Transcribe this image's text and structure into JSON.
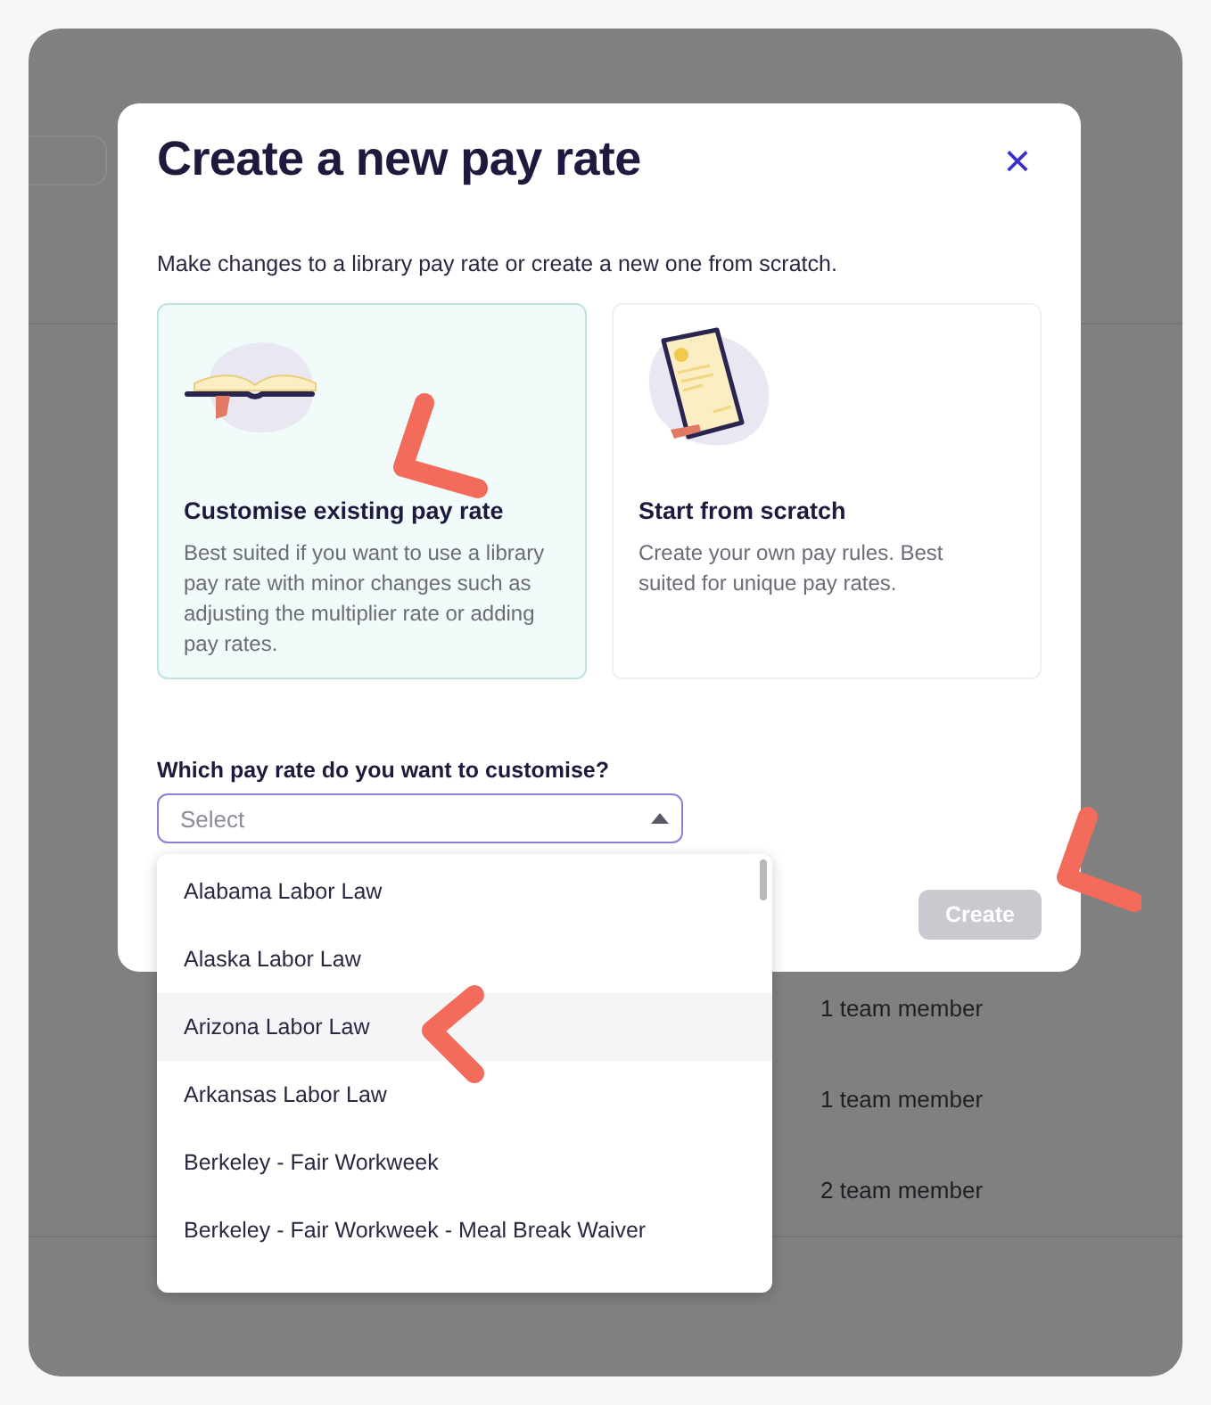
{
  "background_table": {
    "rows": [
      {
        "members": "1 team member"
      },
      {
        "members": "1 team member"
      },
      {
        "members": "2 team member"
      }
    ]
  },
  "dialog": {
    "title": "Create a new pay rate",
    "close": "×",
    "intro": "Make changes to a library pay rate or create a new one from scratch.",
    "options": [
      {
        "kind": "library",
        "title": "Customise existing pay rate",
        "description": "Best suited if you want to use a library pay rate with minor changes such as adjusting the multiplier rate or adding pay rates.",
        "selected": true
      },
      {
        "kind": "scratch",
        "title": "Start from scratch",
        "description": "Create your own pay rules. Best suited for unique pay rates.",
        "selected": false
      }
    ],
    "select_label": "Which pay rate do you want to customise?",
    "select": {
      "placeholder": "Select",
      "expanded": true
    },
    "create_button": {
      "label": "Create",
      "disabled": true
    }
  },
  "dropdown": {
    "items": [
      {
        "label": "Alabama Labor Law",
        "highlighted": false
      },
      {
        "label": "Alaska Labor Law",
        "highlighted": false
      },
      {
        "label": "Arizona Labor Law",
        "highlighted": true
      },
      {
        "label": "Arkansas Labor Law",
        "highlighted": false
      },
      {
        "label": "Berkeley - Fair Workweek",
        "highlighted": false
      },
      {
        "label": "Berkeley - Fair Workweek - Meal Break Waiver",
        "highlighted": false
      }
    ]
  }
}
